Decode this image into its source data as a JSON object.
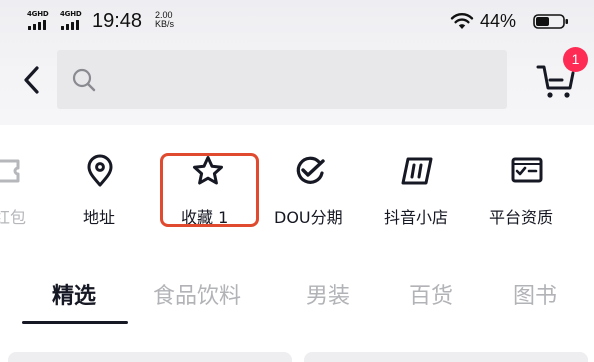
{
  "status_bar": {
    "network_1": "4GHD",
    "network_2": "4GHD",
    "time": "19:48",
    "speed_value": "2.00",
    "speed_unit": "KB/s",
    "battery_pct": "44%"
  },
  "header": {
    "search_placeholder": "",
    "cart_badge": "1"
  },
  "shortcuts": [
    {
      "label": "红包",
      "icon": "coupon-icon"
    },
    {
      "label": "地址",
      "icon": "location-pin-icon"
    },
    {
      "label": "收藏 1",
      "icon": "star-icon"
    },
    {
      "label": "DOU分期",
      "icon": "dou-installment-icon"
    },
    {
      "label": "抖音小店",
      "icon": "shop-bag-icon"
    },
    {
      "label": "平台资质",
      "icon": "certificate-icon"
    }
  ],
  "tabs": [
    {
      "label": "精选",
      "active": true
    },
    {
      "label": "食品饮料",
      "active": false
    },
    {
      "label": "男装",
      "active": false
    },
    {
      "label": "百货",
      "active": false
    },
    {
      "label": "图书",
      "active": false
    }
  ],
  "colors": {
    "accent_red": "#fe2c55",
    "highlight_border": "#e04a2f",
    "text_primary": "#161823",
    "text_muted": "#b2b3b7"
  }
}
